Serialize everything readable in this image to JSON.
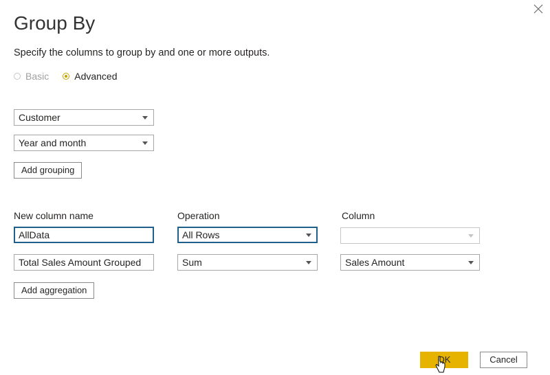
{
  "dialog": {
    "title": "Group By",
    "subtitle": "Specify the columns to group by and one or more outputs.",
    "close_icon": "close-icon"
  },
  "mode": {
    "options": [
      {
        "label": "Basic",
        "checked": false
      },
      {
        "label": "Advanced",
        "checked": true
      }
    ],
    "accent_color": "#c8a200"
  },
  "grouping": {
    "fields": [
      {
        "value": "Customer"
      },
      {
        "value": "Year and month"
      }
    ],
    "add_label": "Add grouping"
  },
  "aggregations": {
    "headers": {
      "new_column_name": "New column name",
      "operation": "Operation",
      "column": "Column"
    },
    "rows": [
      {
        "name": "AllData",
        "operation": "All Rows",
        "column": ""
      },
      {
        "name": "Total Sales Amount Grouped",
        "operation": "Sum",
        "column": "Sales Amount"
      }
    ],
    "add_label": "Add aggregation"
  },
  "footer": {
    "ok_label": "OK",
    "cancel_label": "Cancel",
    "ok_color": "#e6b300"
  },
  "focus_color": "#1f5f8b"
}
